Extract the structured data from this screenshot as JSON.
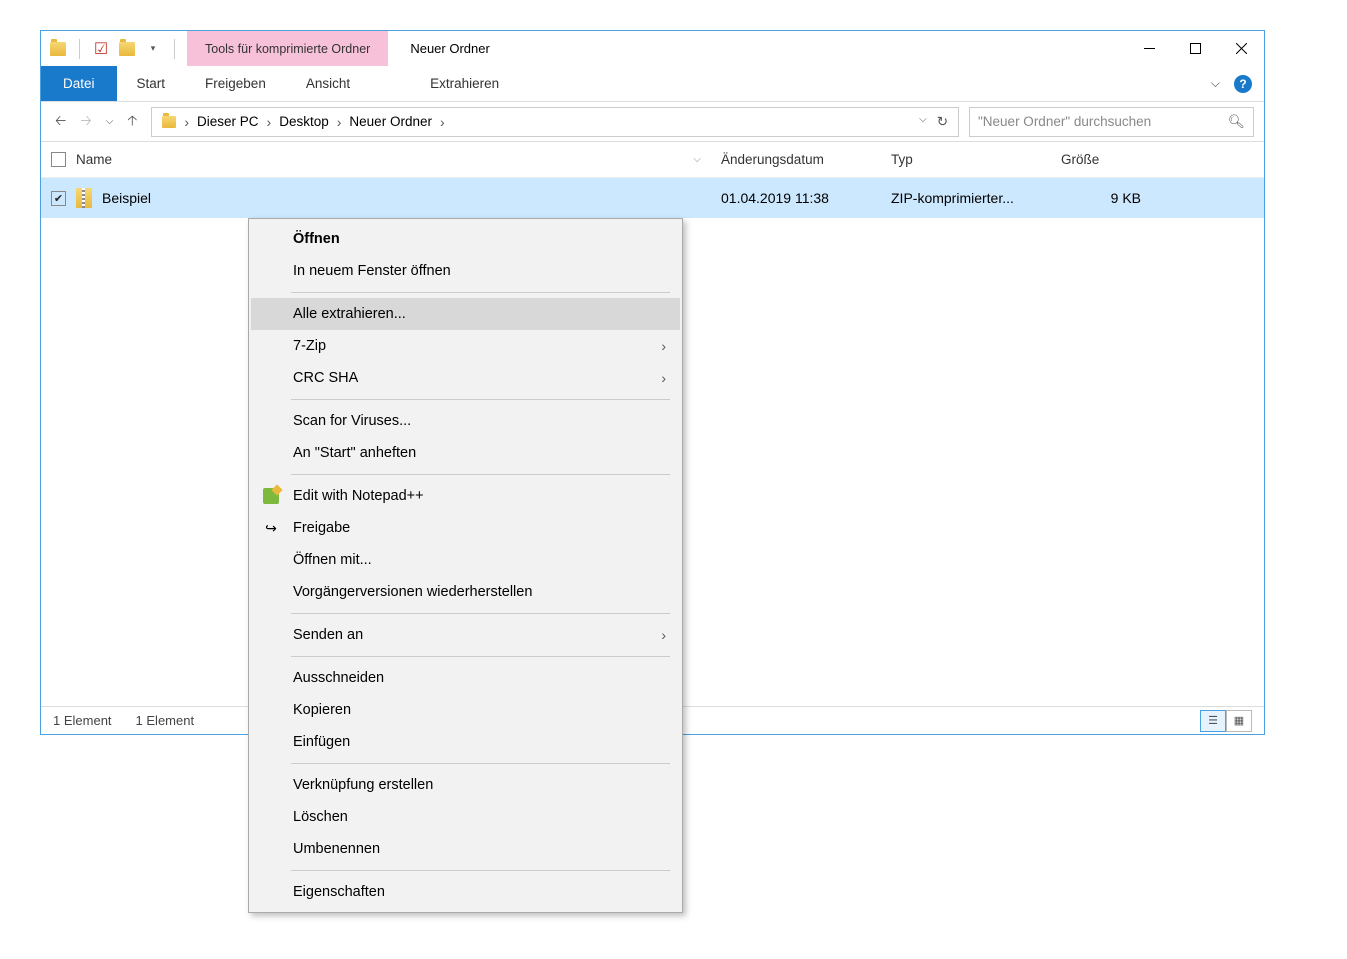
{
  "titlebar": {
    "contextual_label": "Tools für komprimierte Ordner",
    "window_title": "Neuer Ordner"
  },
  "ribbon": {
    "file_tab": "Datei",
    "tabs": [
      "Start",
      "Freigeben",
      "Ansicht"
    ],
    "contextual_tab": "Extrahieren"
  },
  "breadcrumbs": [
    "Dieser PC",
    "Desktop",
    "Neuer Ordner"
  ],
  "search_placeholder": "\"Neuer Ordner\" durchsuchen",
  "columns": {
    "name": "Name",
    "date": "Änderungsdatum",
    "type": "Typ",
    "size": "Größe"
  },
  "file": {
    "name": "Beispiel",
    "date": "01.04.2019 11:38",
    "type": "ZIP-komprimierter...",
    "size": "9 KB"
  },
  "status": {
    "count": "1 Element",
    "selection": "1 Element"
  },
  "context_menu": {
    "open": "Öffnen",
    "open_new_window": "In neuem Fenster öffnen",
    "extract_all": "Alle extrahieren...",
    "seven_zip": "7-Zip",
    "crc_sha": "CRC SHA",
    "scan_viruses": "Scan for Viruses...",
    "pin_start": "An \"Start\" anheften",
    "edit_npp": "Edit with Notepad++",
    "share": "Freigabe",
    "open_with": "Öffnen mit...",
    "restore_versions": "Vorgängerversionen wiederherstellen",
    "send_to": "Senden an",
    "cut": "Ausschneiden",
    "copy": "Kopieren",
    "paste": "Einfügen",
    "create_shortcut": "Verknüpfung erstellen",
    "delete": "Löschen",
    "rename": "Umbenennen",
    "properties": "Eigenschaften"
  }
}
